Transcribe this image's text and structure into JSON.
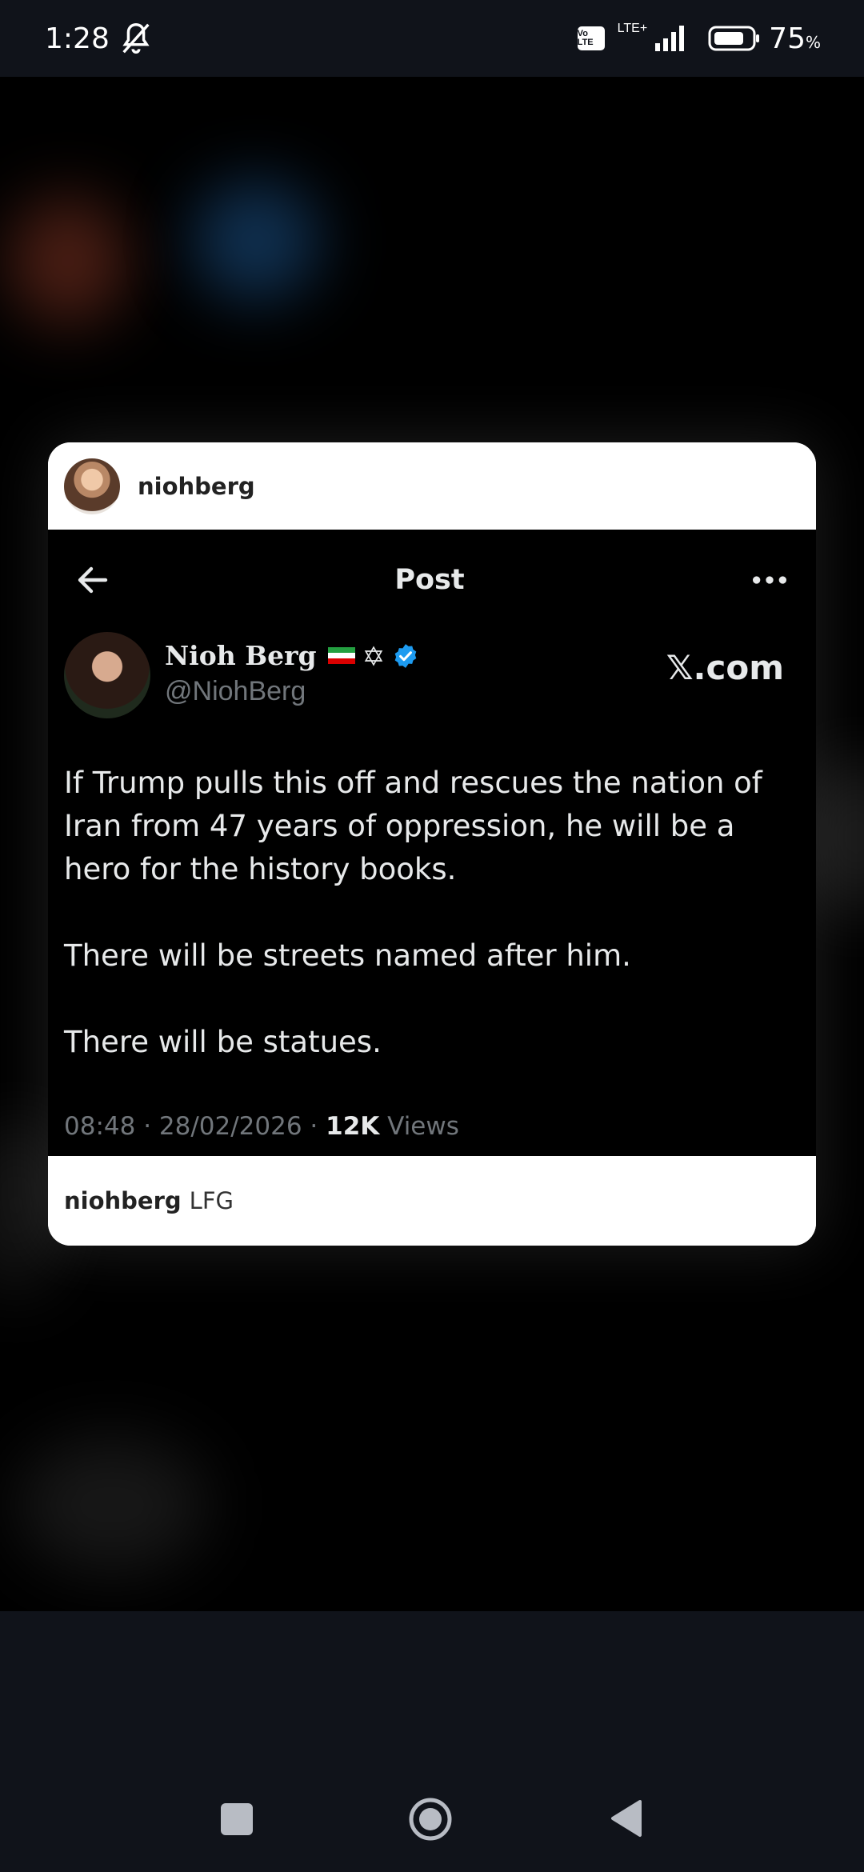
{
  "status_bar": {
    "time": "1:28",
    "volte": "Vo LTE",
    "network": "LTE+",
    "battery_percent": "75",
    "battery_unit": "%"
  },
  "card": {
    "username": "niohberg",
    "tweet": {
      "header_title": "Post",
      "display_name": "Nioh Berg",
      "handle": "@NiohBerg",
      "site": "𝕏.com",
      "paragraphs": [
        "If Trump pulls this off and rescues the nation of Iran from 47 years of oppression, he will be a hero for the history books.",
        "There will be streets named after him.",
        "There will be statues."
      ],
      "timestamp": "08:48 · 28/02/2026 · ",
      "views_count": "12K",
      "views_label": " Views"
    },
    "caption": {
      "user": "niohberg",
      "text": "LFG"
    }
  },
  "colors": {
    "verified_blue": "#1d9bf0",
    "muted_text": "#71767b"
  },
  "icons": [
    "bell-off-icon",
    "signal-icon",
    "battery-icon",
    "back-arrow-icon",
    "more-icon",
    "verified-icon",
    "star-of-david-icon",
    "iran-flag-icon",
    "recents-icon",
    "home-icon",
    "back-icon"
  ]
}
